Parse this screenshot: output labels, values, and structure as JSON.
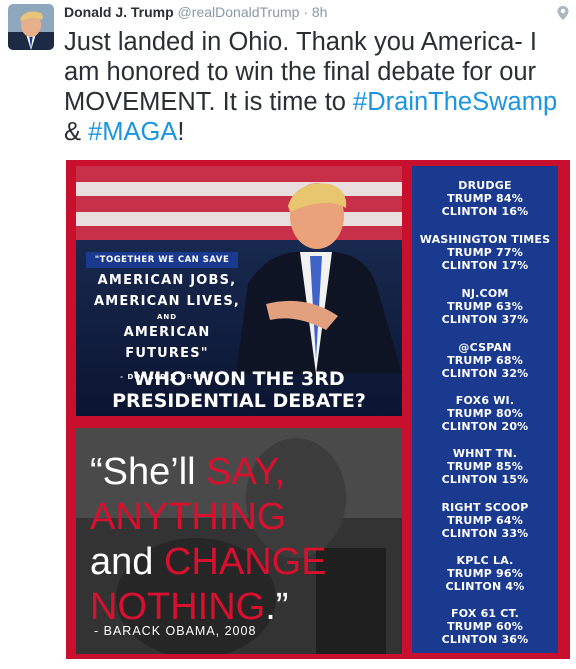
{
  "tweet": {
    "name": "Donald J. Trump",
    "handle": "@realDonaldTrump",
    "separator": "·",
    "time": "8h",
    "text_1": "Just landed in Ohio. Thank you America- I am honored to win the final debate for our MOVEMENT. It is time to ",
    "hashtag_1": "#DrainTheSwamp",
    "text_2": " & ",
    "hashtag_2": "#MAGA",
    "text_3": "!"
  },
  "colors": {
    "accent": "#1b95e0",
    "panel_red": "#c8102e",
    "panel_blue": "#1a3a8f"
  },
  "icons": {
    "location": "map-pin-icon"
  },
  "graphic": {
    "badge": "\"TOGETHER WE CAN SAVE",
    "line1": "AMERICAN JOBS,",
    "line2": "AMERICAN LIVES,",
    "and": "AND",
    "line3": "AMERICAN FUTURES\"",
    "attribution": "- DONALD J. TRUMP",
    "question_1": "WHO WON THE 3RD",
    "question_2": "PRESIDENTIAL DEBATE?",
    "quote": {
      "open": "“She’ll ",
      "w_say": "SAY,",
      "w_anything": "ANYTHING",
      "w_and": "and ",
      "w_change": "CHANGE",
      "w_nothing": "NOTHING",
      "close": ".”",
      "attribution": "- BARACK OBAMA, 2008"
    }
  },
  "polls": [
    {
      "source": "DRUDGE",
      "trump": "TRUMP 84%",
      "clinton": "CLINTON 16%"
    },
    {
      "source": "WASHINGTON TIMES",
      "trump": "TRUMP 77%",
      "clinton": "CLINTON 17%"
    },
    {
      "source": "NJ.COM",
      "trump": "TRUMP 63%",
      "clinton": "CLINTON 37%"
    },
    {
      "source": "@CSPAN",
      "trump": "TRUMP 68%",
      "clinton": "CLINTON 32%"
    },
    {
      "source": "FOX6 WI.",
      "trump": "TRUMP 80%",
      "clinton": "CLINTON 20%"
    },
    {
      "source": "WHNT TN.",
      "trump": "TRUMP 85%",
      "clinton": "CLINTON 15%"
    },
    {
      "source": "RIGHT SCOOP",
      "trump": "TRUMP 64%",
      "clinton": "CLINTON 33%"
    },
    {
      "source": "KPLC LA.",
      "trump": "TRUMP 96%",
      "clinton": "CLINTON 4%"
    },
    {
      "source": "FOX 61 CT.",
      "trump": "TRUMP 60%",
      "clinton": "CLINTON 36%"
    }
  ]
}
